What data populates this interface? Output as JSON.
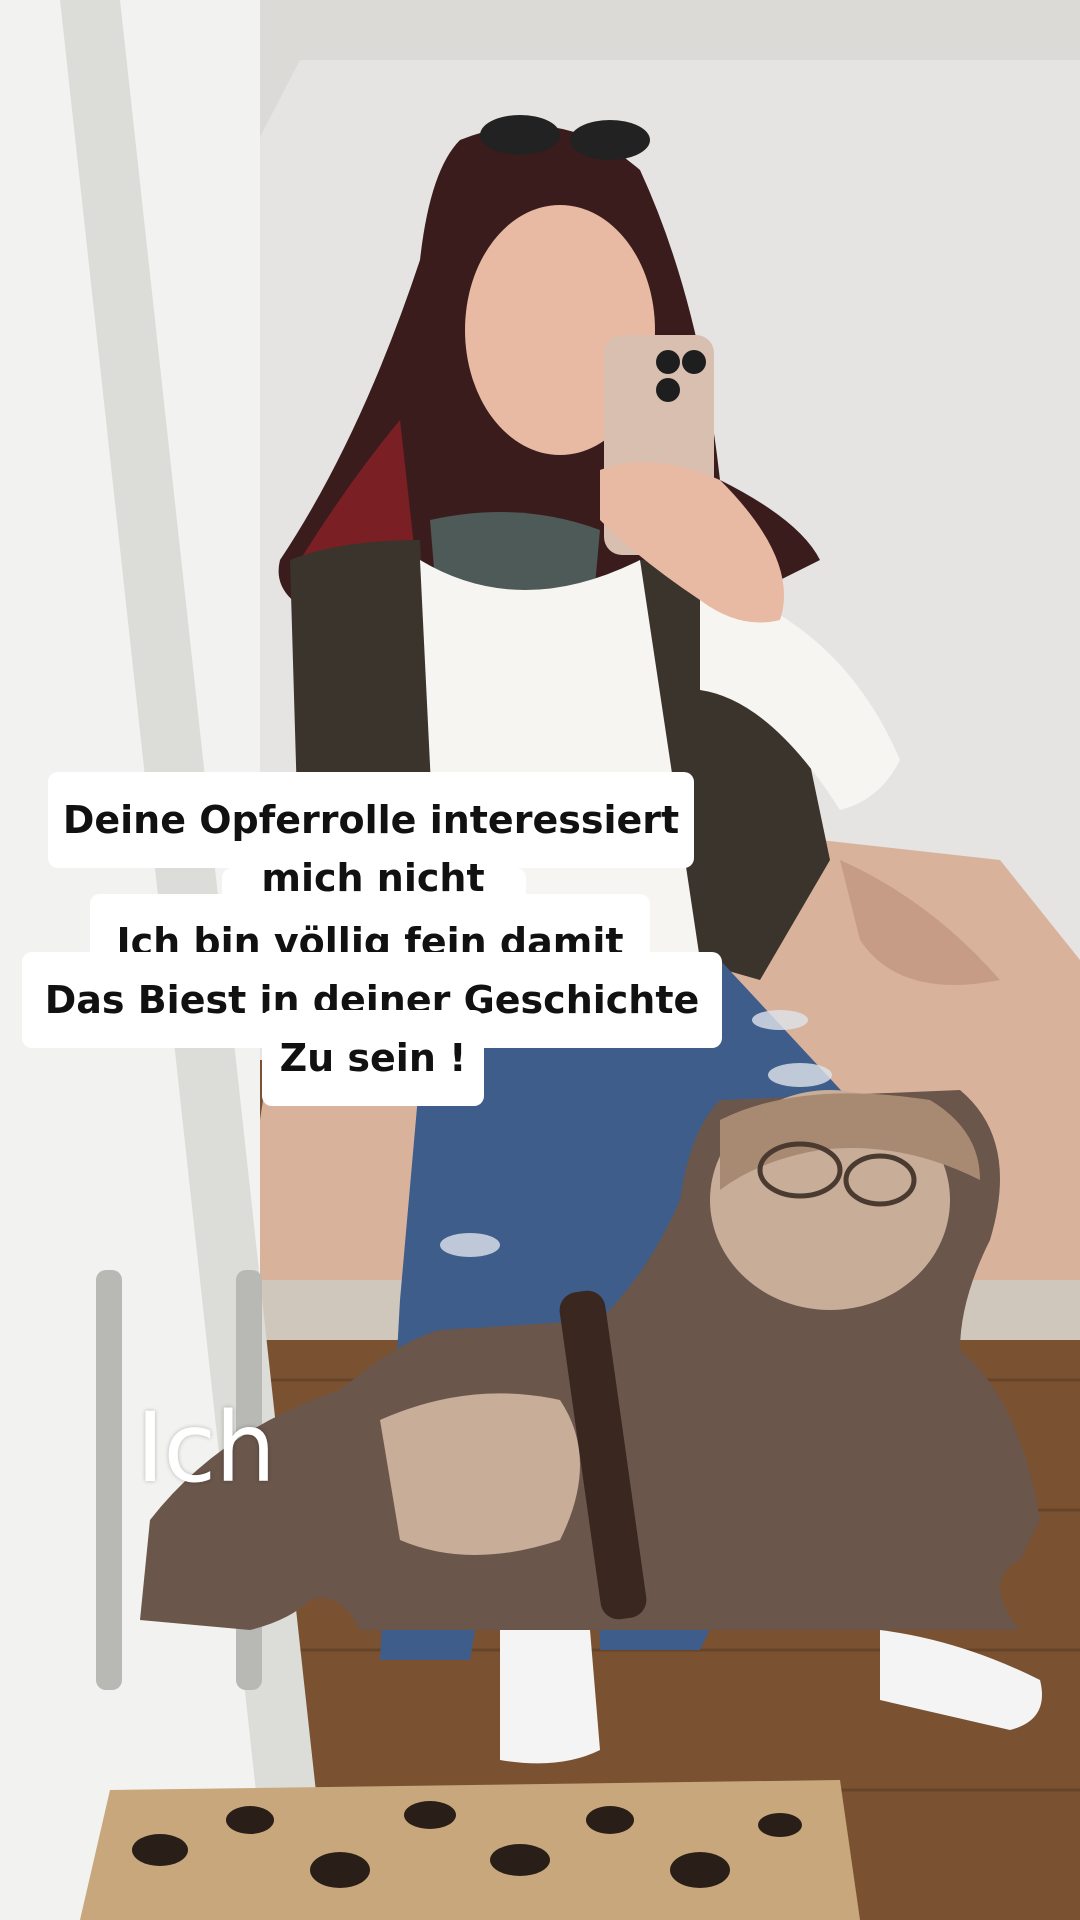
{
  "caption": {
    "line1": "Deine Opferrolle interessiert",
    "line2": "mich nicht",
    "line3": "Ich bin völlig fein damit",
    "line4": "Das Biest in deiner Geschichte",
    "line5": "Zu sein !"
  },
  "sticker": {
    "label": "Ich"
  },
  "colors": {
    "caption_background": "#ffffff",
    "caption_text": "#111111",
    "sticker_text": "#ffffff"
  }
}
